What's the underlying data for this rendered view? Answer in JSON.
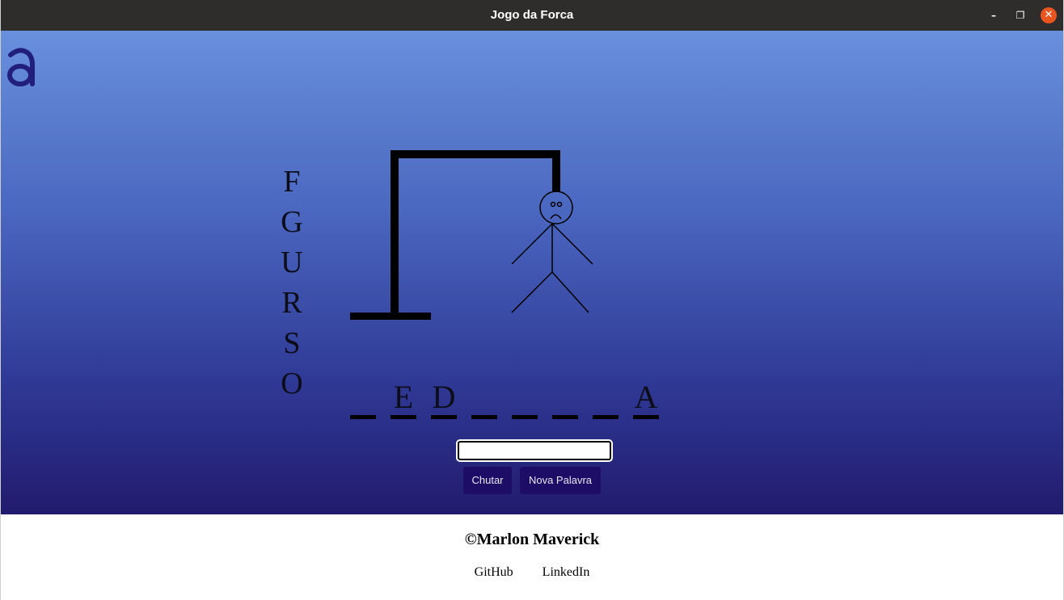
{
  "window": {
    "title": "Jogo da Forca",
    "minimize_icon": "–",
    "maximize_icon": "❐",
    "close_icon": "✕"
  },
  "logo": {
    "glyph": "a",
    "color": "#211f7a"
  },
  "game": {
    "wrong_letters": [
      "F",
      "G",
      "U",
      "R",
      "S",
      "O"
    ],
    "word_slots": [
      "",
      "E",
      "D",
      "",
      "",
      "",
      "",
      "A"
    ],
    "guess_input_value": "",
    "guess_button": "Chutar",
    "new_word_button": "Nova Palavra"
  },
  "footer": {
    "copyright": "©Marlon Maverick",
    "links": [
      "GitHub",
      "LinkedIn"
    ]
  },
  "colors": {
    "titlebar": "#2f2d2c",
    "close_button": "#e9541f",
    "gradient_top": "#6890dc",
    "gradient_bottom": "#221b6e",
    "button_bg": "#1d0d66"
  }
}
